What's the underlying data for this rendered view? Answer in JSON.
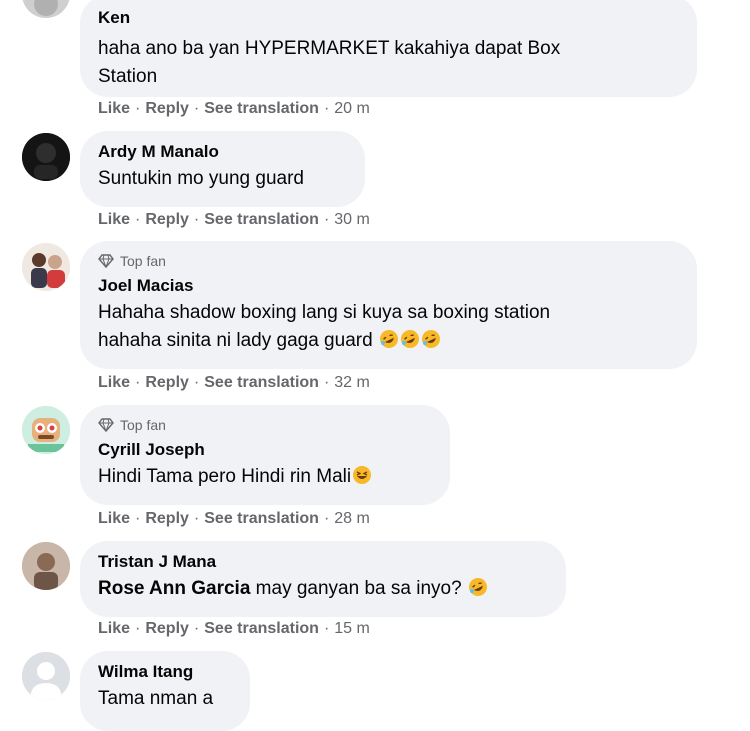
{
  "actions": {
    "like": "Like",
    "reply": "Reply",
    "translate": "See translation",
    "separator": "·"
  },
  "badge_label": "Top fan",
  "comments": [
    {
      "author": "Ken",
      "lines": [
        "haha ano ba yan HYPERMARKET kakahiya dapat Box",
        "Station"
      ],
      "time": "20 m",
      "avatar_icon": "user-avatar"
    },
    {
      "author": "Ardy M Manalo",
      "lines": [
        "Suntukin mo yung guard"
      ],
      "time": "30 m",
      "avatar_icon": "user-avatar"
    },
    {
      "author": "Joel Macias",
      "top_fan": true,
      "lines": [
        "Hahaha shadow boxing lang si kuya sa boxing station",
        "hahaha sinita ni lady gaga guard"
      ],
      "emoji": [
        "rofl-emoji",
        "rofl-emoji",
        "rofl-emoji"
      ],
      "time": "32 m",
      "avatar_icon": "user-avatar"
    },
    {
      "author": "Cyrill Joseph",
      "top_fan": true,
      "lines": [
        "Hindi Tama pero Hindi rin Mali"
      ],
      "emoji": [
        "laughing-emoji"
      ],
      "time": "28 m",
      "avatar_icon": "cartoon-avatar"
    },
    {
      "author": "Tristan J Mana",
      "mention": "Rose Ann Garcia",
      "lines": [
        " may ganyan ba sa inyo?"
      ],
      "emoji": [
        "rofl-emoji"
      ],
      "time": "15 m",
      "avatar_icon": "user-avatar"
    },
    {
      "author": "Wilma Itang",
      "lines": [
        "Tama nman a"
      ],
      "avatar_icon": "default-avatar"
    }
  ]
}
